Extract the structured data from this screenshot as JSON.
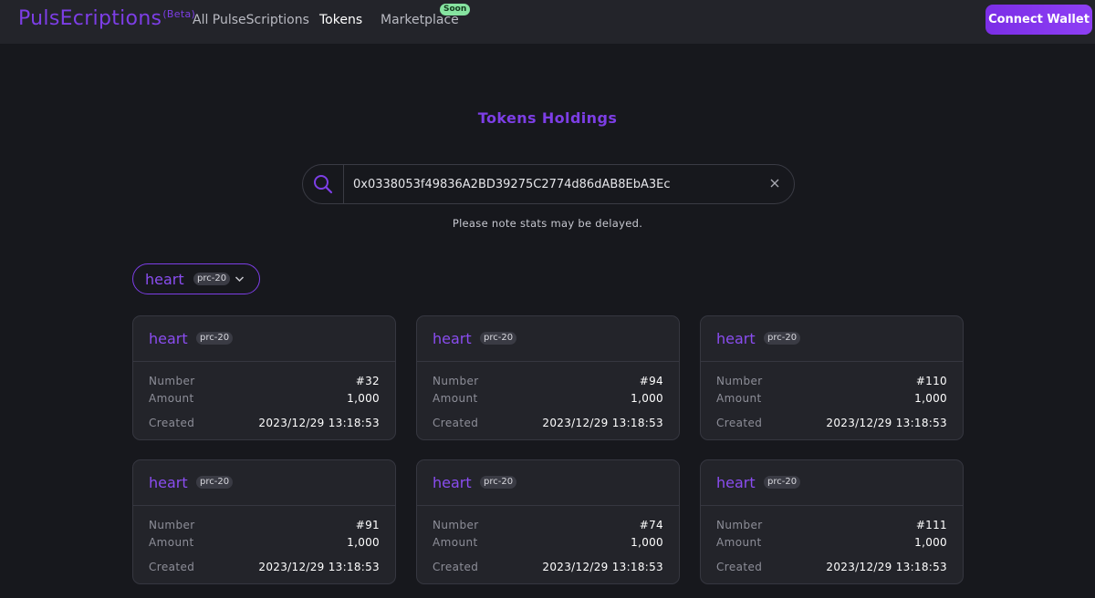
{
  "header": {
    "brand": "PulsEcriptions",
    "beta": "(Beta)",
    "nav": [
      {
        "label": "All PulseScriptions"
      },
      {
        "label": "Tokens"
      },
      {
        "label": "Marketplace"
      }
    ],
    "soon_badge": "Soon",
    "connect_label": "Connect Wallet"
  },
  "colors": {
    "accent": "#7d3ee6",
    "background": "#17181d",
    "card_background": "#23242a",
    "soon_badge": "#86e3a0"
  },
  "page": {
    "title": "Tokens Holdings",
    "note": "Please note stats may be delayed."
  },
  "search": {
    "value": "0x0338053f49836A2BD39275C2774d86dAB8EbA3Ec"
  },
  "filter": {
    "token": "heart",
    "standard": "prc-20"
  },
  "labels": {
    "number": "Number",
    "amount": "Amount",
    "created": "Created"
  },
  "cards": [
    {
      "token": "heart",
      "standard": "prc-20",
      "number": "#32",
      "amount": "1,000",
      "created": "2023/12/29 13:18:53"
    },
    {
      "token": "heart",
      "standard": "prc-20",
      "number": "#94",
      "amount": "1,000",
      "created": "2023/12/29 13:18:53"
    },
    {
      "token": "heart",
      "standard": "prc-20",
      "number": "#110",
      "amount": "1,000",
      "created": "2023/12/29 13:18:53"
    },
    {
      "token": "heart",
      "standard": "prc-20",
      "number": "#91",
      "amount": "1,000",
      "created": "2023/12/29 13:18:53"
    },
    {
      "token": "heart",
      "standard": "prc-20",
      "number": "#74",
      "amount": "1,000",
      "created": "2023/12/29 13:18:53"
    },
    {
      "token": "heart",
      "standard": "prc-20",
      "number": "#111",
      "amount": "1,000",
      "created": "2023/12/29 13:18:53"
    }
  ]
}
